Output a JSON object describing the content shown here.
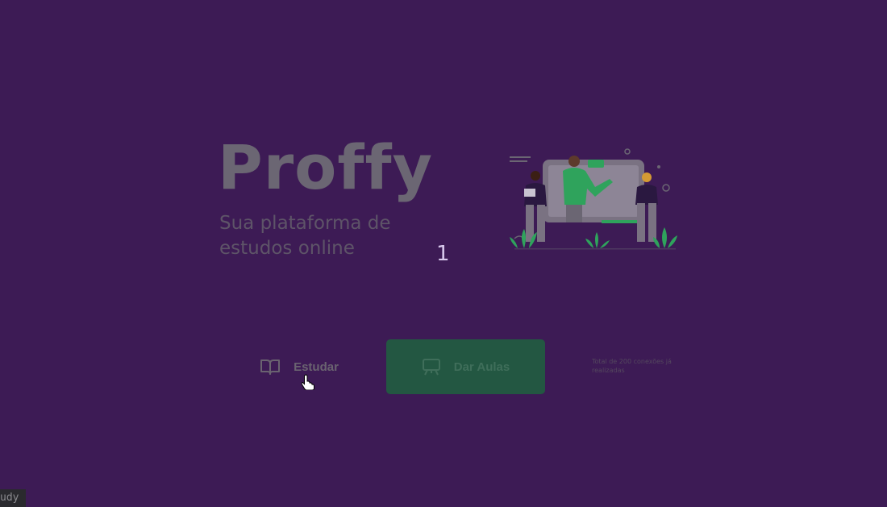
{
  "brand": {
    "logo_text": "Proffy",
    "tagline": "Sua plataforma de estudos online"
  },
  "counter": "1",
  "actions": {
    "study_label": "Estudar",
    "study_icon": "book-open-icon",
    "give_classes_label": "Dar Aulas",
    "give_classes_icon": "presentation-board-icon"
  },
  "connections_text": "Total de 200 conexões já realizadas",
  "status_tip": "udy",
  "colors": {
    "background": "#3d1b55",
    "logo": "#6b6673",
    "primary_button": "#235742",
    "accent_green": "#2fa35c"
  }
}
